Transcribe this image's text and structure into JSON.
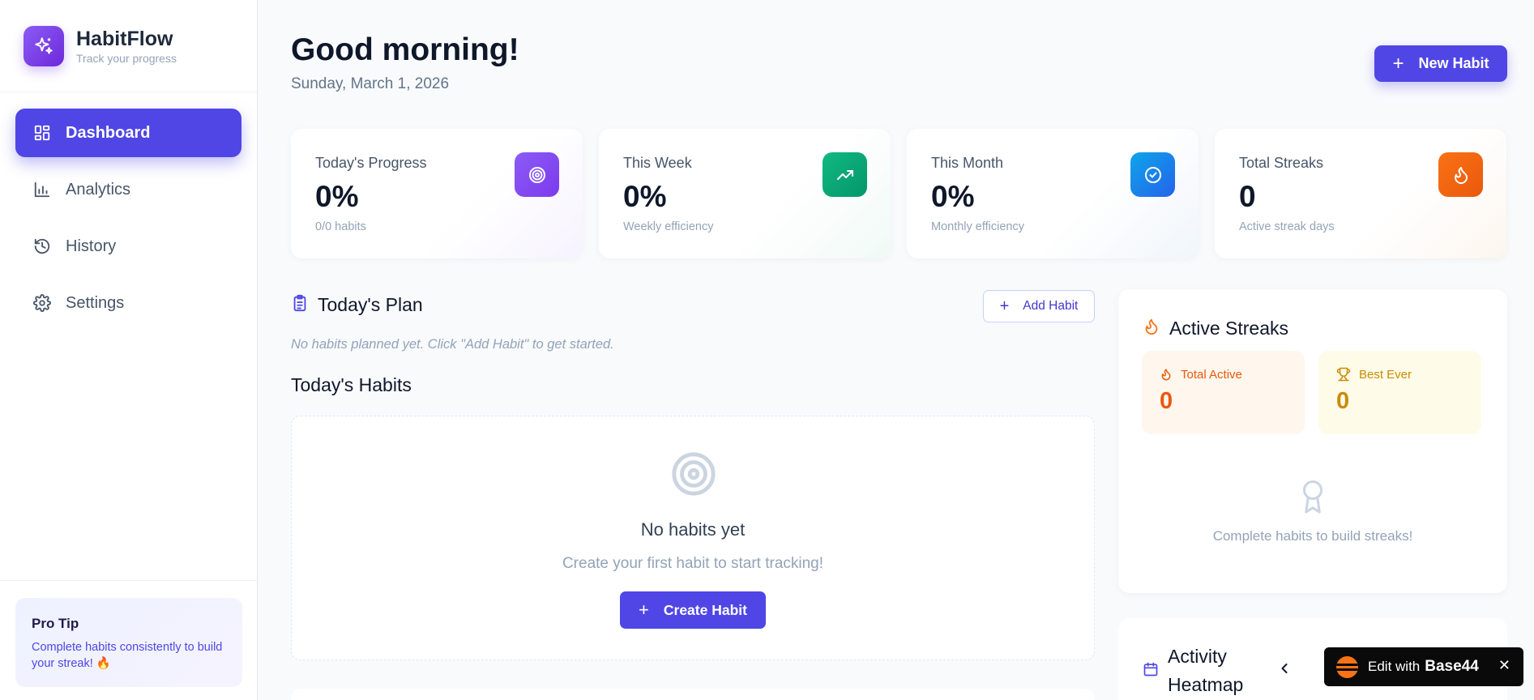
{
  "brand": {
    "name": "HabitFlow",
    "subtitle": "Track your progress",
    "logo_icon": "sparkles-icon",
    "accent": "#4f46e5"
  },
  "nav": {
    "items": [
      {
        "label": "Dashboard",
        "icon": "dashboard-icon",
        "active": true
      },
      {
        "label": "Analytics",
        "icon": "bar-chart-icon",
        "active": false
      },
      {
        "label": "History",
        "icon": "history-icon",
        "active": false
      },
      {
        "label": "Settings",
        "icon": "gear-icon",
        "active": false
      }
    ]
  },
  "tip": {
    "title": "Pro Tip",
    "text": "Complete habits consistently to build your streak! 🔥"
  },
  "header": {
    "greeting": "Good morning!",
    "date": "Sunday, March 1, 2026",
    "new_habit_label": "New Habit"
  },
  "stats": [
    {
      "label": "Today's Progress",
      "value": "0%",
      "sub": "0/0 habits",
      "icon": "target-icon",
      "color": "#8b5cf6"
    },
    {
      "label": "This Week",
      "value": "0%",
      "sub": "Weekly efficiency",
      "icon": "trending-up-icon",
      "color": "#10b981"
    },
    {
      "label": "This Month",
      "value": "0%",
      "sub": "Monthly efficiency",
      "icon": "check-circle-icon",
      "color": "#0ea5e9"
    },
    {
      "label": "Total Streaks",
      "value": "0",
      "sub": "Active streak days",
      "icon": "flame-icon",
      "color": "#f97316"
    }
  ],
  "plan": {
    "title": "Today's Plan",
    "add_label": "Add Habit",
    "empty_text": "No habits planned yet. Click \"Add Habit\" to get started."
  },
  "habits": {
    "title": "Today's Habits",
    "empty_title": "No habits yet",
    "empty_sub": "Create your first habit to start tracking!",
    "create_label": "Create Habit"
  },
  "streaks": {
    "title": "Active Streaks",
    "total_active_label": "Total Active",
    "total_active_value": "0",
    "best_ever_label": "Best Ever",
    "best_ever_value": "0",
    "empty_text": "Complete habits to build streaks!"
  },
  "heatmap": {
    "title": "Activity Heatmap"
  },
  "badge": {
    "text": "Edit with",
    "brand": "Base44",
    "close": "✕"
  }
}
